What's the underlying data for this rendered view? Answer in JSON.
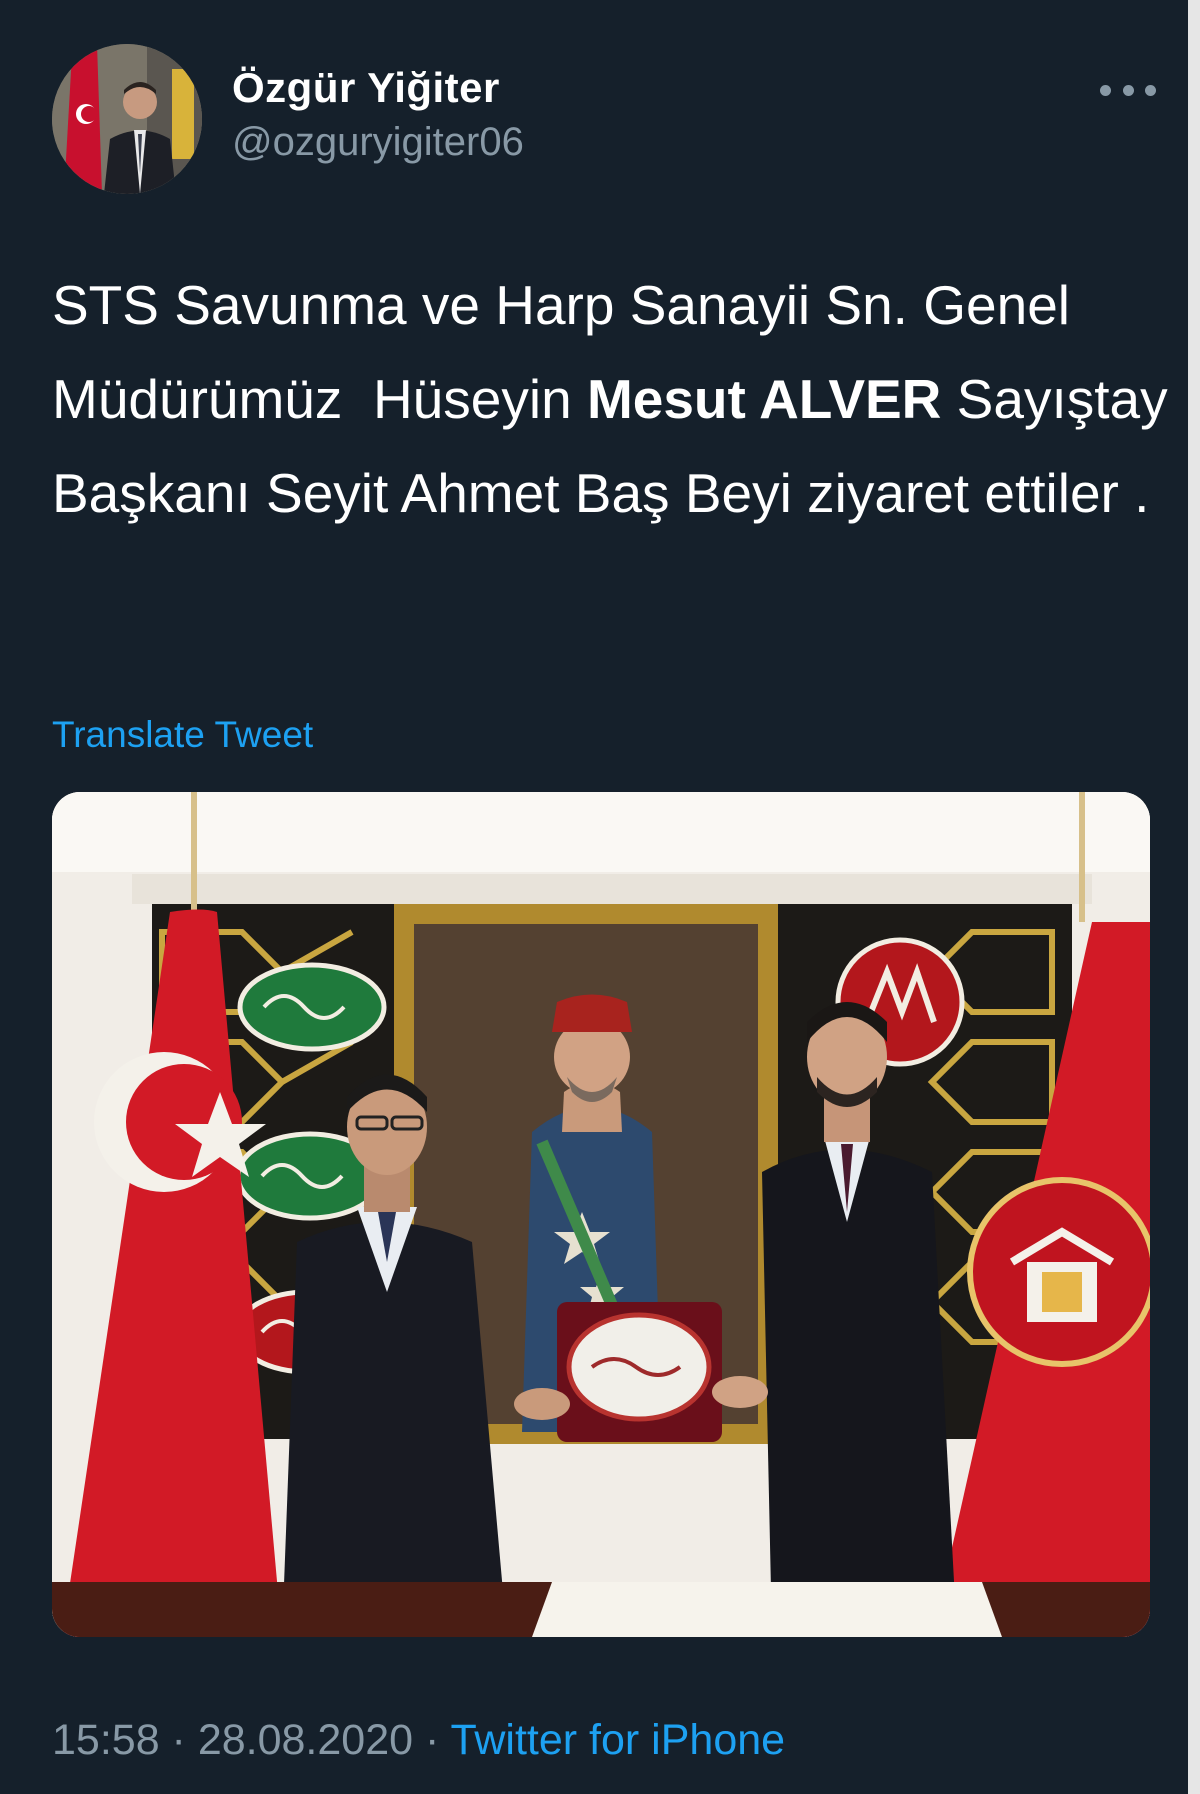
{
  "author": {
    "display_name": "Özgür Yiğiter",
    "handle": "@ozguryigiter06"
  },
  "tweet": {
    "text_part1": "STS Savunma ve Harp Sanayii Sn. Genel Müdürümüz  Hüseyin ",
    "text_bold": "Mesut ALVER",
    "text_part2": " Sayıştay Başkanı Seyit Ahmet Baş Beyi ziyaret ettiler .",
    "translate_label": "Translate Tweet"
  },
  "meta": {
    "time": "15:58",
    "separator": " · ",
    "date": "28.08.2020",
    "source": "Twitter for iPhone"
  },
  "colors": {
    "background": "#15202b",
    "accent": "#1da1f2",
    "secondary_text": "#8899a6"
  },
  "icons": {
    "more": "more-horizontal-icon"
  }
}
